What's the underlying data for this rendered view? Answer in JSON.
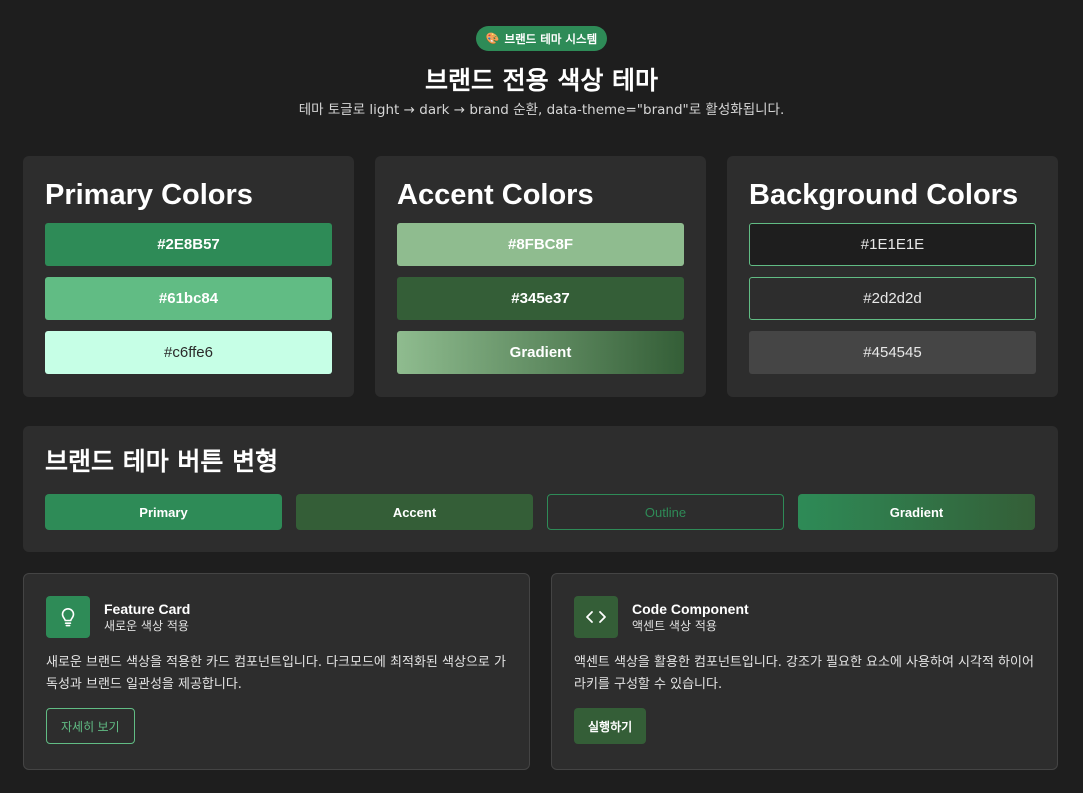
{
  "header": {
    "badge_emoji": "🎨",
    "badge": "브랜드 테마 시스템",
    "title": "브랜드 전용 색상 테마",
    "subtitle": "테마 토글로 light → dark → brand 순환, data-theme=\"brand\"로 활성화됩니다."
  },
  "color_groups": [
    {
      "title": "Primary Colors",
      "swatches": [
        {
          "label": "#2E8B57",
          "color": "#2E8B57"
        },
        {
          "label": "#61bc84",
          "color": "#61bc84"
        },
        {
          "label": "#c6ffe6",
          "color": "#c6ffe6"
        }
      ]
    },
    {
      "title": "Accent Colors",
      "swatches": [
        {
          "label": "#8FBC8F",
          "color": "#8FBC8F"
        },
        {
          "label": "#345e37",
          "color": "#345e37"
        },
        {
          "label": "Gradient",
          "color": "linear-gradient(#8fbc8f, #345e37)"
        }
      ]
    },
    {
      "title": "Background Colors",
      "swatches": [
        {
          "label": "#1E1E1E",
          "color": "#1E1E1E"
        },
        {
          "label": "#2d2d2d",
          "color": "#2d2d2d"
        },
        {
          "label": "#454545",
          "color": "#454545"
        }
      ]
    }
  ],
  "button_variants": {
    "title": "브랜드 테마 버튼 변형",
    "buttons": [
      "Primary",
      "Accent",
      "Outline",
      "Gradient"
    ]
  },
  "cards": [
    {
      "icon": "lightbulb-icon",
      "title": "Feature Card",
      "subtitle": "새로운 색상 적용",
      "description": "새로운 브랜드 색상을 적용한 카드 컴포넌트입니다. 다크모드에 최적화된 색상으로 가독성과 브랜드 일관성을 제공합니다.",
      "button": "자세히 보기"
    },
    {
      "icon": "code-brackets-icon",
      "title": "Code Component",
      "subtitle": "액센트 색상 적용",
      "description": "액센트 색상을 활용한 컴포넌트입니다. 강조가 필요한 요소에 사용하여 시각적 하이어라키를 구성할 수 있습니다.",
      "button": "실행하기"
    }
  ],
  "colors": {
    "background": "#1e1e1e",
    "surface": "#2d2d2d",
    "primary": "#2e8b57",
    "primary_light": "#61bc84",
    "accent": "#345e37"
  }
}
